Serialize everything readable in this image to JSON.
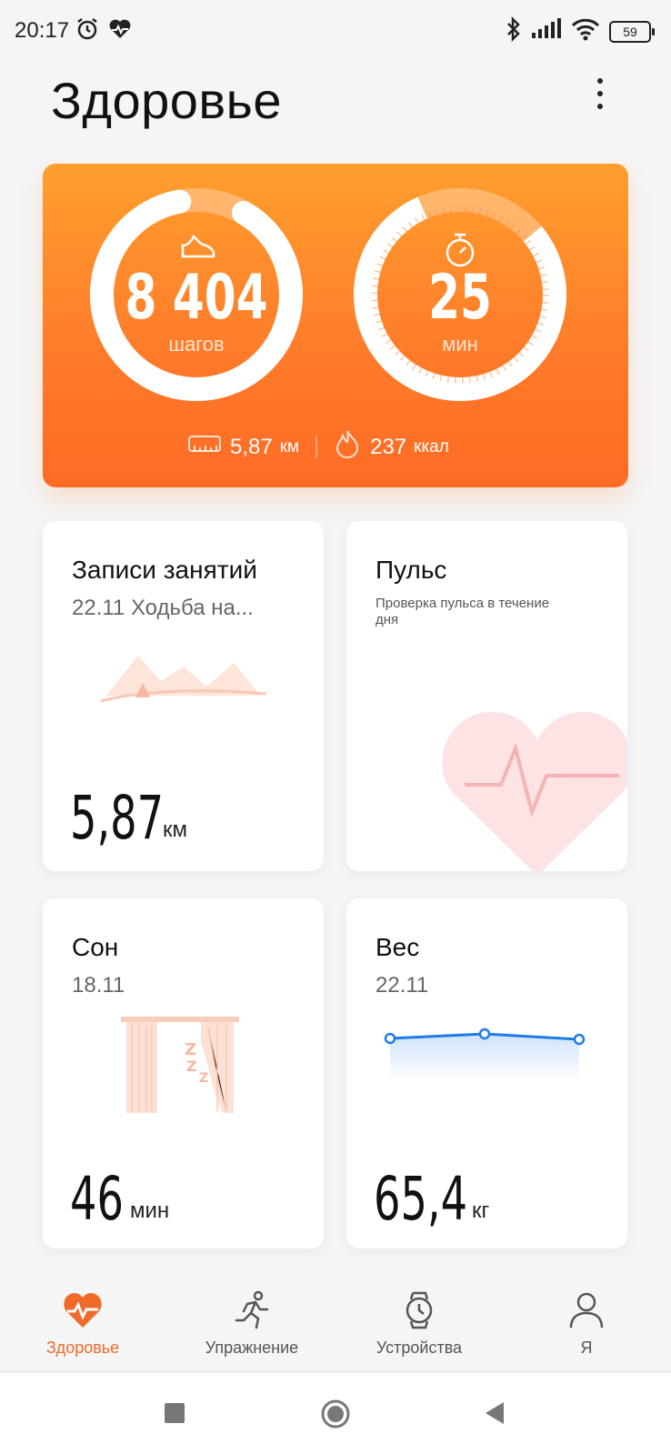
{
  "status_bar": {
    "time": "20:17",
    "battery": "59"
  },
  "header": {
    "title": "Здоровье"
  },
  "activity": {
    "steps_value": "8 404",
    "steps_unit": "шагов",
    "minutes_value": "25",
    "minutes_unit": "мин",
    "distance_value": "5,87",
    "distance_unit": "км",
    "calories_value": "237",
    "calories_unit": "ккал"
  },
  "tiles": {
    "workouts": {
      "title": "Записи занятий",
      "subtitle": "22.11 Ходьба на...",
      "value": "5,87",
      "unit": "км"
    },
    "pulse": {
      "title": "Пульс",
      "description": "Проверка пульса в течение дня"
    },
    "sleep": {
      "title": "Сон",
      "subtitle": "18.11",
      "value": "46",
      "unit": "мин"
    },
    "weight": {
      "title": "Вес",
      "subtitle": "22.11",
      "value": "65,4",
      "unit": "кг"
    }
  },
  "bottom_nav": {
    "items": [
      {
        "label": "Здоровье",
        "icon": "heart-pulse-icon",
        "active": true
      },
      {
        "label": "Упражнение",
        "icon": "running-icon",
        "active": false
      },
      {
        "label": "Устройства",
        "icon": "watch-icon",
        "active": false
      },
      {
        "label": "Я",
        "icon": "profile-icon",
        "active": false
      }
    ]
  },
  "colors": {
    "accent": "#f06a2a",
    "card_top": "#ff9f2e",
    "card_bottom": "#ff6b25"
  }
}
